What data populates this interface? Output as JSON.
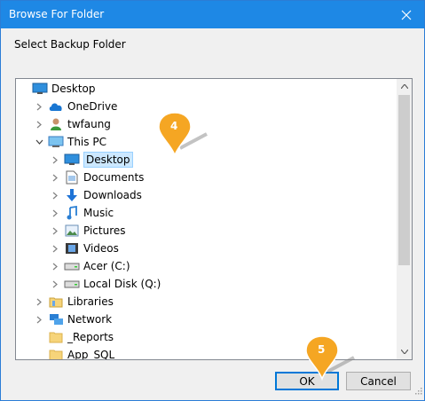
{
  "window": {
    "title": "Browse For Folder",
    "close_icon": "close-icon"
  },
  "prompt": "Select Backup Folder",
  "tree": {
    "items": [
      {
        "label": "Desktop",
        "icon": "desktop-icon",
        "expander": ""
      },
      {
        "label": "OneDrive",
        "icon": "cloud-icon",
        "expander": "collapsed"
      },
      {
        "label": "twfaung",
        "icon": "user-icon",
        "expander": "collapsed"
      },
      {
        "label": "This PC",
        "icon": "computer-icon",
        "expander": "expanded"
      },
      {
        "label": "Desktop",
        "icon": "desktop-icon",
        "expander": "collapsed",
        "selected": true
      },
      {
        "label": "Documents",
        "icon": "document-icon",
        "expander": "collapsed"
      },
      {
        "label": "Downloads",
        "icon": "download-icon",
        "expander": "collapsed"
      },
      {
        "label": "Music",
        "icon": "music-icon",
        "expander": "collapsed"
      },
      {
        "label": "Pictures",
        "icon": "picture-icon",
        "expander": "collapsed"
      },
      {
        "label": "Videos",
        "icon": "video-icon",
        "expander": "collapsed"
      },
      {
        "label": "Acer (C:)",
        "icon": "drive-icon",
        "expander": "collapsed"
      },
      {
        "label": "Local Disk (Q:)",
        "icon": "drive-icon",
        "expander": "collapsed"
      },
      {
        "label": "Libraries",
        "icon": "library-icon",
        "expander": "collapsed"
      },
      {
        "label": "Network",
        "icon": "network-icon",
        "expander": "collapsed"
      },
      {
        "label": "_Reports",
        "icon": "folder-icon",
        "expander": ""
      },
      {
        "label": "App_SQL",
        "icon": "folder-icon",
        "expander": ""
      }
    ]
  },
  "buttons": {
    "ok": "OK",
    "cancel": "Cancel"
  },
  "callouts": {
    "step4": "4",
    "step5": "5"
  },
  "colors": {
    "titlebar": "#1e88e5",
    "selection": "#cce8ff",
    "callout": "#f5a623",
    "ok_border": "#0078d7"
  }
}
